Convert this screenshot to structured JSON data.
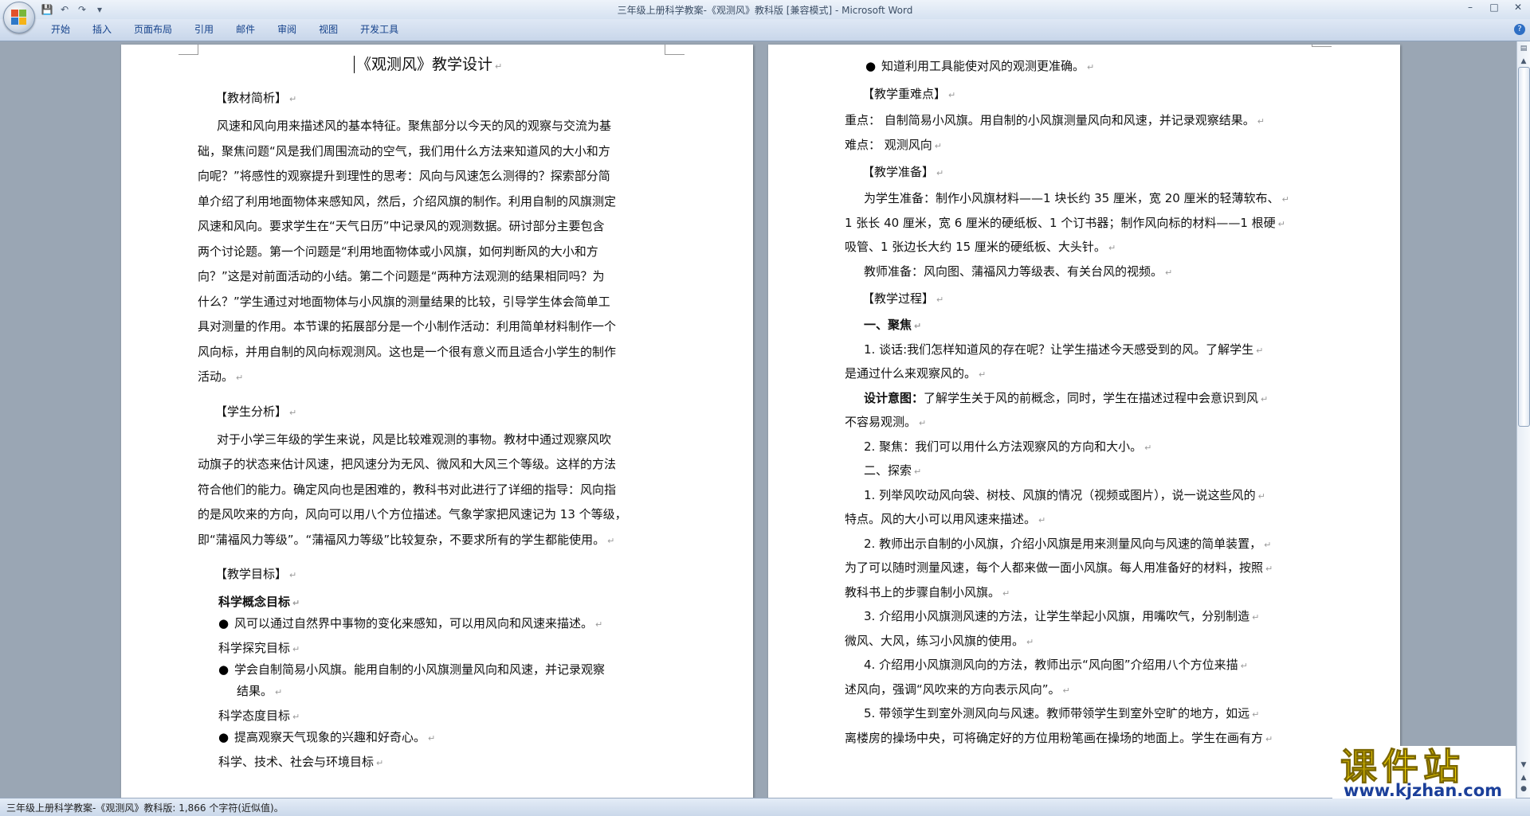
{
  "window": {
    "title": "三年级上册科学教案-《观测风》教科版 [兼容模式] - Microsoft Word"
  },
  "ribbon": {
    "tabs": [
      "开始",
      "插入",
      "页面布局",
      "引用",
      "邮件",
      "审阅",
      "视图",
      "开发工具"
    ]
  },
  "page1": {
    "title": "《观测风》教学设计",
    "sections": [
      {
        "kind": "head",
        "text": "【教材简析】"
      },
      {
        "kind": "para",
        "lines": [
          "风速和风向用来描述风的基本特征。聚焦部分以今天的风的观察与交流为基",
          "础，聚焦问题“风是我们周围流动的空气，我们用什么方法来知道风的大小和方",
          "向呢？”将感性的观察提升到理性的思考：风向与风速怎么测得的？探索部分简",
          "单介绍了利用地面物体来感知风，然后，介绍风旗的制作。利用自制的风旗测定",
          "风速和风向。要求学生在“天气日历”中记录风的观测数据。研讨部分主要包含",
          "两个讨论题。第一个问题是“利用地面物体或小风旗，如何判断风的大小和方",
          "向？”这是对前面活动的小结。第二个问题是“两种方法观测的结果相同吗？为",
          "什么？”学生通过对地面物体与小风旗的测量结果的比较，引导学生体会简单工",
          "具对测量的作用。本节课的拓展部分是一个小制作活动：利用简单材料制作一个",
          "风向标，并用自制的风向标观测风。这也是一个很有意义而且适合小学生的制作",
          "活动。"
        ]
      },
      {
        "kind": "head",
        "text": "【学生分析】"
      },
      {
        "kind": "para",
        "lines": [
          "对于小学三年级的学生来说，风是比较难观测的事物。教材中通过观察风吹",
          "动旗子的状态来估计风速，把风速分为无风、微风和大风三个等级。这样的方法",
          "符合他们的能力。确定风向也是困难的，教科书对此进行了详细的指导：风向指",
          "的是风吹来的方向，风向可以用八个方位描述。气象学家把风速记为 13 个等级，",
          "即“蒲福风力等级”。“蒲福风力等级”比较复杂，不要求所有的学生都能使用。"
        ]
      },
      {
        "kind": "head",
        "text": "【教学目标】"
      },
      {
        "kind": "sub",
        "text": "科学概念目标",
        "bold": true
      },
      {
        "kind": "bullet",
        "lines": [
          "风可以通过自然界中事物的变化来感知，可以用风向和风速来描述。"
        ]
      },
      {
        "kind": "sub",
        "text": "科学探究目标"
      },
      {
        "kind": "bullet",
        "lines": [
          "学会自制简易小风旗。能用自制的小风旗测量风向和风速，并记录观察",
          "结果。"
        ]
      },
      {
        "kind": "sub",
        "text": "科学态度目标"
      },
      {
        "kind": "bullet",
        "lines": [
          "提高观察天气现象的兴趣和好奇心。"
        ]
      },
      {
        "kind": "sub",
        "text": "科学、技术、社会与环境目标"
      }
    ]
  },
  "page2": {
    "lines": [
      {
        "kind": "bullet",
        "text": "知道利用工具能使对风的观测更准确。"
      },
      {
        "kind": "head",
        "text": "【教学重难点】"
      },
      {
        "kind": "plain",
        "text": "重点：  自制简易小风旗。用自制的小风旗测量风向和风速，并记录观察结果。"
      },
      {
        "kind": "plain",
        "text": "难点：  观测风向"
      },
      {
        "kind": "head",
        "text": "【教学准备】"
      },
      {
        "kind": "indent",
        "text": "为学生准备：制作小风旗材料——1 块长约 35 厘米，宽 20 厘米的轻薄软布、"
      },
      {
        "kind": "plain",
        "text": "1 张长 40 厘米，宽 6 厘米的硬纸板、1 个订书器；制作风向标的材料——1 根硬"
      },
      {
        "kind": "plain",
        "text": "吸管、1 张边长大约 15 厘米的硬纸板、大头针。"
      },
      {
        "kind": "indent",
        "text": "教师准备：风向图、蒲福风力等级表、有关台风的视频。"
      },
      {
        "kind": "head",
        "text": "【教学过程】"
      },
      {
        "kind": "indentb",
        "text": "一、聚焦"
      },
      {
        "kind": "indent",
        "text": "1. 谈话:我们怎样知道风的存在呢？让学生描述今天感受到的风。了解学生"
      },
      {
        "kind": "plain",
        "text": "是通过什么来观察风的。"
      },
      {
        "kind": "design",
        "bold": "设计意图：",
        "text": "了解学生关于风的前概念，同时，学生在描述过程中会意识到风"
      },
      {
        "kind": "plain",
        "text": "不容易观测。"
      },
      {
        "kind": "indent",
        "text": "2. 聚焦：我们可以用什么方法观察风的方向和大小。"
      },
      {
        "kind": "indent",
        "text": "二、探索"
      },
      {
        "kind": "indent",
        "text": "1. 列举风吹动风向袋、树枝、风旗的情况（视频或图片），说一说这些风的"
      },
      {
        "kind": "plain",
        "text": "特点。风的大小可以用风速来描述。"
      },
      {
        "kind": "indent",
        "text": "2. 教师出示自制的小风旗，介绍小风旗是用来测量风向与风速的简单装置，"
      },
      {
        "kind": "plain",
        "text": "为了可以随时测量风速，每个人都来做一面小风旗。每人用准备好的材料，按照"
      },
      {
        "kind": "plain",
        "text": "教科书上的步骤自制小风旗。"
      },
      {
        "kind": "indent",
        "text": "3. 介绍用小风旗测风速的方法，让学生举起小风旗，用嘴吹气，分别制造"
      },
      {
        "kind": "plain",
        "text": "微风、大风，练习小风旗的使用。"
      },
      {
        "kind": "indent",
        "text": "4. 介绍用小风旗测风向的方法，教师出示“风向图”介绍用八个方位来描"
      },
      {
        "kind": "plain",
        "text": "述风向，强调“风吹来的方向表示风向”。"
      },
      {
        "kind": "indent",
        "text": "5. 带领学生到室外测风向与风速。教师带领学生到室外空旷的地方，如远"
      },
      {
        "kind": "plain",
        "text": "离楼房的操场中央，可将确定好的方位用粉笔画在操场的地面上。学生在画有方"
      }
    ]
  },
  "statusbar": {
    "text": "三年级上册科学教案-《观测风》教科版: 1,866 个字符(近似值)。"
  },
  "watermark": {
    "brand": "课件站",
    "url": "www.kjzhan.com"
  },
  "colors": {
    "workspace": "#9aa6b4",
    "ribbon_text": "#15428b",
    "watermark_yellow": "#f2d200",
    "watermark_blue": "#1b3f9a"
  }
}
